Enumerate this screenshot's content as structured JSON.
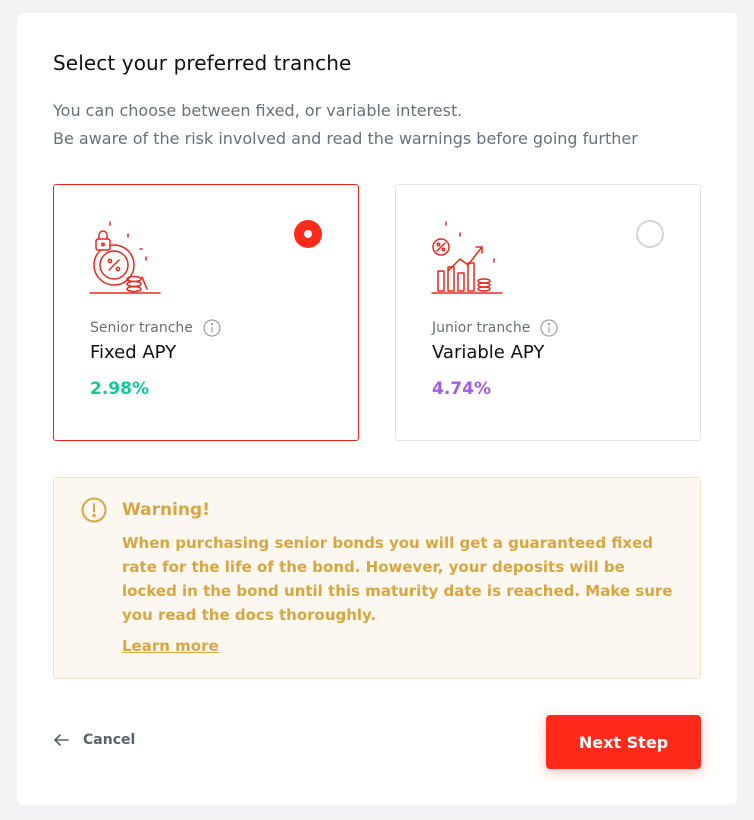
{
  "header": {
    "title": "Select your preferred tranche",
    "subtitle_line1": "You can choose between fixed, or variable interest.",
    "subtitle_line2": "Be aware of the risk involved and read the warnings before going further"
  },
  "tranches": [
    {
      "label": "Senior tranche",
      "type": "Fixed APY",
      "rate": "2.98%",
      "rate_color": "#10c99a",
      "selected": true,
      "icon": "locked-percent-coins-icon"
    },
    {
      "label": "Junior tranche",
      "type": "Variable APY",
      "rate": "4.74%",
      "rate_color": "#a35ce6",
      "selected": false,
      "icon": "percent-growth-chart-icon"
    }
  ],
  "warning": {
    "title": "Warning!",
    "text": "When purchasing senior bonds you will get a guaranteed fixed rate for the life of the bond. However, your deposits will be locked in the bond until this maturity date is reached. Make sure you read the docs thoroughly.",
    "link": "Learn more",
    "icon": "exclamation-circle-icon",
    "color": "#d8a640"
  },
  "footer": {
    "cancel_label": "Cancel",
    "next_label": "Next Step"
  },
  "colors": {
    "accent": "#ff2a1a",
    "selected_border": "#e8281e"
  }
}
